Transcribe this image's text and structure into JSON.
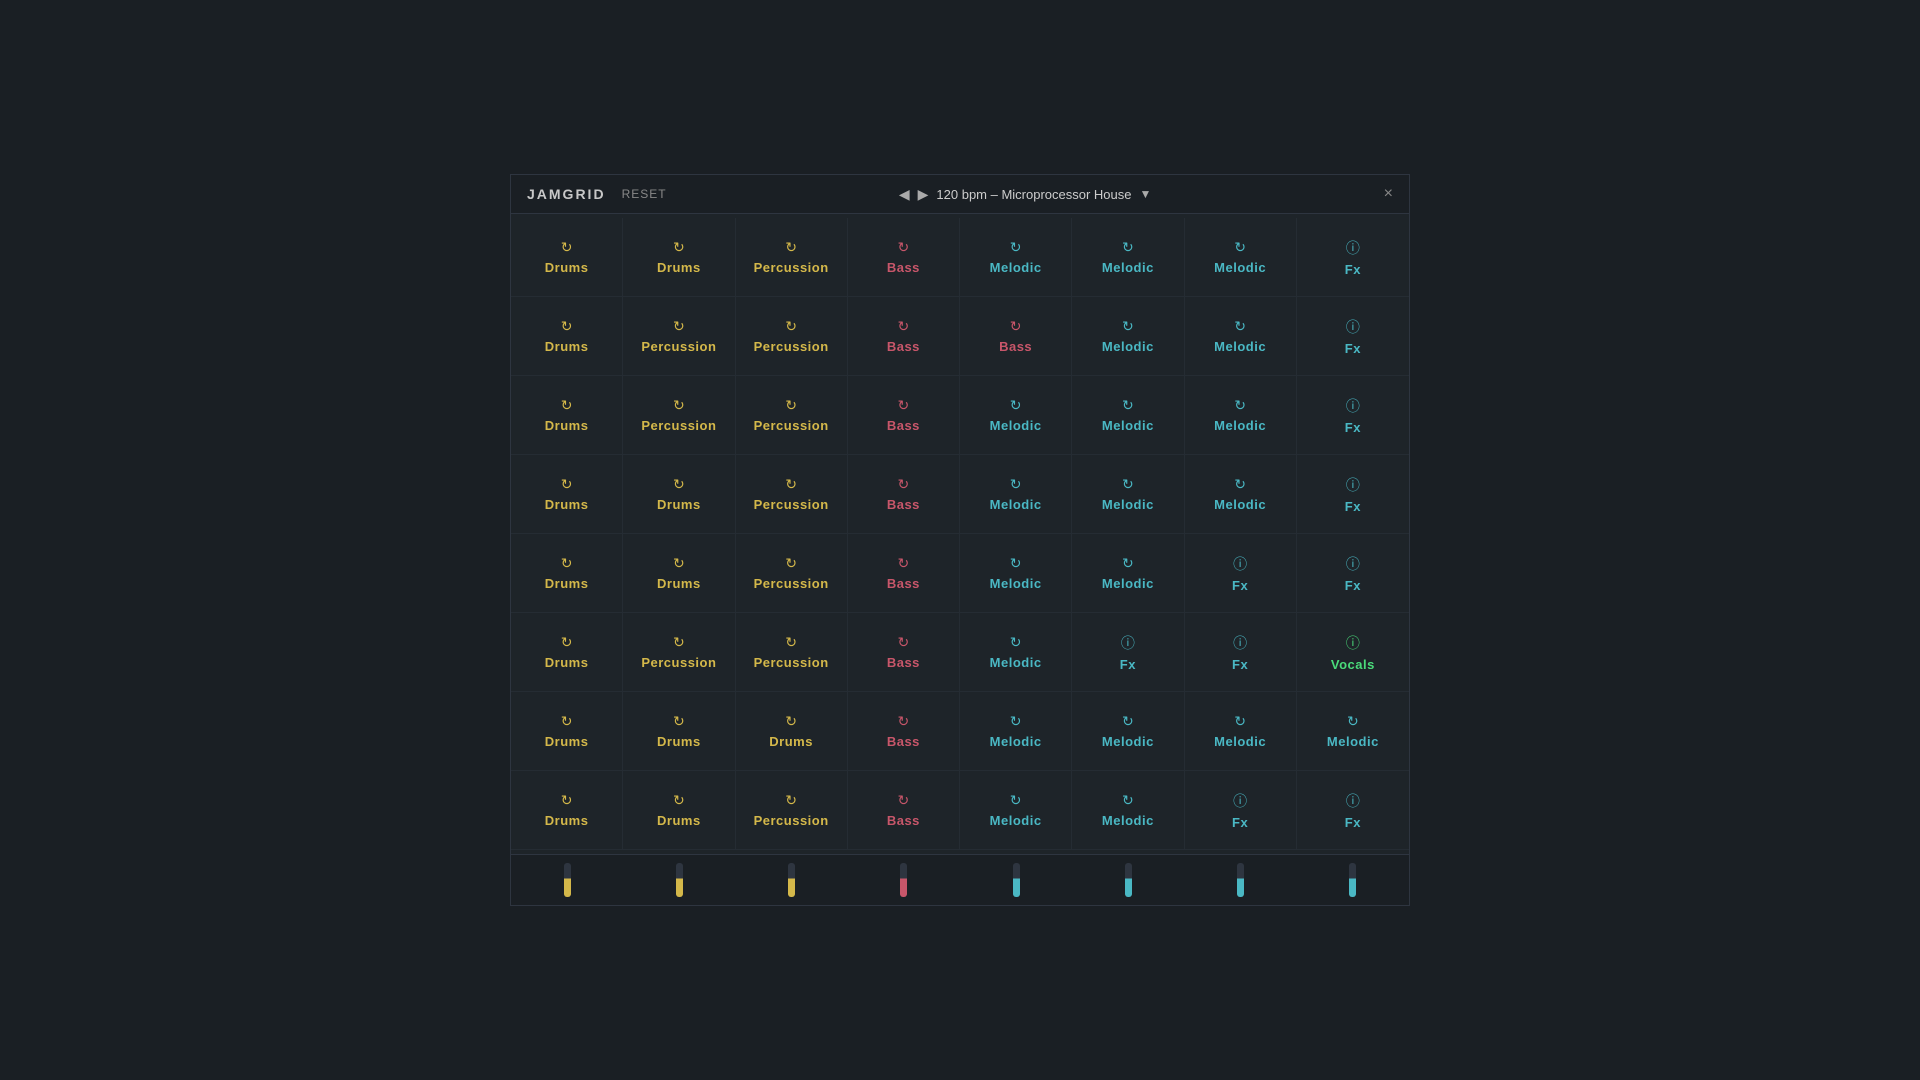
{
  "app": {
    "title": "JAMGRID",
    "reset_label": "RESET",
    "bpm_display": "120 bpm – Microprocessor House",
    "close_icon": "×"
  },
  "grid": {
    "rows": [
      [
        {
          "type": "drums",
          "label": "Drums",
          "icon": "refresh"
        },
        {
          "type": "drums",
          "label": "Drums",
          "icon": "refresh"
        },
        {
          "type": "percussion",
          "label": "Percussion",
          "icon": "refresh"
        },
        {
          "type": "bass",
          "label": "Bass",
          "icon": "refresh"
        },
        {
          "type": "melodic",
          "label": "Melodic",
          "icon": "refresh"
        },
        {
          "type": "melodic",
          "label": "Melodic",
          "icon": "refresh"
        },
        {
          "type": "melodic",
          "label": "Melodic",
          "icon": "refresh"
        },
        {
          "type": "fx",
          "label": "Fx",
          "icon": "info"
        }
      ],
      [
        {
          "type": "drums",
          "label": "Drums",
          "icon": "refresh"
        },
        {
          "type": "percussion",
          "label": "Percussion",
          "icon": "refresh"
        },
        {
          "type": "percussion",
          "label": "Percussion",
          "icon": "refresh"
        },
        {
          "type": "bass",
          "label": "Bass",
          "icon": "refresh"
        },
        {
          "type": "bass",
          "label": "Bass",
          "icon": "refresh"
        },
        {
          "type": "melodic",
          "label": "Melodic",
          "icon": "refresh"
        },
        {
          "type": "melodic",
          "label": "Melodic",
          "icon": "refresh"
        },
        {
          "type": "fx",
          "label": "Fx",
          "icon": "info"
        }
      ],
      [
        {
          "type": "drums",
          "label": "Drums",
          "icon": "refresh"
        },
        {
          "type": "percussion",
          "label": "Percussion",
          "icon": "refresh"
        },
        {
          "type": "percussion",
          "label": "Percussion",
          "icon": "refresh"
        },
        {
          "type": "bass",
          "label": "Bass",
          "icon": "refresh"
        },
        {
          "type": "melodic",
          "label": "Melodic",
          "icon": "refresh"
        },
        {
          "type": "melodic",
          "label": "Melodic",
          "icon": "refresh"
        },
        {
          "type": "melodic",
          "label": "Melodic",
          "icon": "refresh"
        },
        {
          "type": "fx",
          "label": "Fx",
          "icon": "info"
        }
      ],
      [
        {
          "type": "drums",
          "label": "Drums",
          "icon": "refresh"
        },
        {
          "type": "drums",
          "label": "Drums",
          "icon": "refresh"
        },
        {
          "type": "percussion",
          "label": "Percussion",
          "icon": "refresh"
        },
        {
          "type": "bass",
          "label": "Bass",
          "icon": "refresh"
        },
        {
          "type": "melodic",
          "label": "Melodic",
          "icon": "refresh"
        },
        {
          "type": "melodic",
          "label": "Melodic",
          "icon": "refresh"
        },
        {
          "type": "melodic",
          "label": "Melodic",
          "icon": "refresh"
        },
        {
          "type": "fx",
          "label": "Fx",
          "icon": "info"
        }
      ],
      [
        {
          "type": "drums",
          "label": "Drums",
          "icon": "refresh"
        },
        {
          "type": "drums",
          "label": "Drums",
          "icon": "refresh"
        },
        {
          "type": "percussion",
          "label": "Percussion",
          "icon": "refresh"
        },
        {
          "type": "bass",
          "label": "Bass",
          "icon": "refresh"
        },
        {
          "type": "melodic",
          "label": "Melodic",
          "icon": "refresh"
        },
        {
          "type": "melodic",
          "label": "Melodic",
          "icon": "refresh"
        },
        {
          "type": "fx",
          "label": "Fx",
          "icon": "info"
        },
        {
          "type": "fx",
          "label": "Fx",
          "icon": "info"
        }
      ],
      [
        {
          "type": "drums",
          "label": "Drums",
          "icon": "refresh"
        },
        {
          "type": "percussion",
          "label": "Percussion",
          "icon": "refresh"
        },
        {
          "type": "percussion",
          "label": "Percussion",
          "icon": "refresh"
        },
        {
          "type": "bass",
          "label": "Bass",
          "icon": "refresh"
        },
        {
          "type": "melodic",
          "label": "Melodic",
          "icon": "refresh"
        },
        {
          "type": "fx",
          "label": "Fx",
          "icon": "info"
        },
        {
          "type": "fx",
          "label": "Fx",
          "icon": "info"
        },
        {
          "type": "vocals",
          "label": "Vocals",
          "icon": "info"
        }
      ],
      [
        {
          "type": "drums",
          "label": "Drums",
          "icon": "refresh"
        },
        {
          "type": "drums",
          "label": "Drums",
          "icon": "refresh"
        },
        {
          "type": "drums",
          "label": "Drums",
          "icon": "refresh"
        },
        {
          "type": "bass",
          "label": "Bass",
          "icon": "refresh"
        },
        {
          "type": "melodic",
          "label": "Melodic",
          "icon": "refresh"
        },
        {
          "type": "melodic",
          "label": "Melodic",
          "icon": "refresh"
        },
        {
          "type": "melodic",
          "label": "Melodic",
          "icon": "refresh"
        },
        {
          "type": "melodic",
          "label": "Melodic",
          "icon": "refresh"
        }
      ],
      [
        {
          "type": "drums",
          "label": "Drums",
          "icon": "refresh"
        },
        {
          "type": "drums",
          "label": "Drums",
          "icon": "refresh"
        },
        {
          "type": "percussion",
          "label": "Percussion",
          "icon": "refresh"
        },
        {
          "type": "bass",
          "label": "Bass",
          "icon": "refresh"
        },
        {
          "type": "melodic",
          "label": "Melodic",
          "icon": "refresh"
        },
        {
          "type": "melodic",
          "label": "Melodic",
          "icon": "refresh"
        },
        {
          "type": "fx",
          "label": "Fx",
          "icon": "info"
        },
        {
          "type": "fx",
          "label": "Fx",
          "icon": "info"
        }
      ]
    ]
  },
  "footer": {
    "columns": [
      {
        "type": "drums"
      },
      {
        "type": "drums"
      },
      {
        "type": "drums"
      },
      {
        "type": "bass"
      },
      {
        "type": "melodic"
      },
      {
        "type": "melodic"
      },
      {
        "type": "melodic"
      },
      {
        "type": "melodic"
      }
    ]
  }
}
